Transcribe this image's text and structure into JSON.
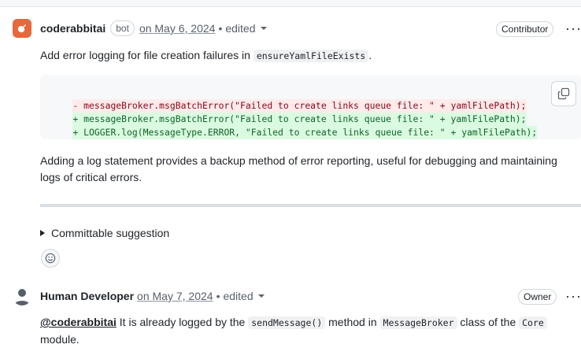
{
  "comments": [
    {
      "author": "coderabbitai",
      "bot_badge": "bot",
      "date": "on May 6, 2024",
      "separator": "•",
      "edited": "edited",
      "role": "Contributor",
      "more": "···",
      "intro_prefix": "Add error logging for file creation failures in ",
      "intro_code": "ensureYamlFileExists",
      "intro_suffix": ".",
      "code_lines": [
        "- messageBroker.msgBatchError(\"Failed to create links queue file: \" + yamlFilePath);",
        "+ messageBroker.msgBatchError(\"Failed to create links queue file: \" + yamlFilePath);",
        "+ LOGGER.log(MessageType.ERROR, \"Failed to create links queue file: \" + yamlFilePath);"
      ],
      "explanation": "Adding a log statement provides a backup method of error reporting, useful for debugging and maintaining logs of critical errors.",
      "summary": "Committable suggestion"
    },
    {
      "author": "Human Developer",
      "date": "on May 7, 2024",
      "separator": "•",
      "edited": "edited",
      "role": "Owner",
      "more": "···",
      "mention": "@coderabbitai",
      "text_1": " It is already logged by the ",
      "code_1": "sendMessage()",
      "text_2": " method in ",
      "code_2": "MessageBroker",
      "text_3": " class of the ",
      "code_3": "Core",
      "text_4": "module."
    }
  ],
  "colors": {
    "bot_avatar": "#e8683e",
    "deletion_bg": "#ffebe9",
    "addition_bg": "#dafbe1"
  },
  "icons": [
    "rabbit-logo-icon",
    "copy-icon",
    "smiley-icon",
    "person-icon",
    "caret-down-icon",
    "triangle-right-icon"
  ]
}
